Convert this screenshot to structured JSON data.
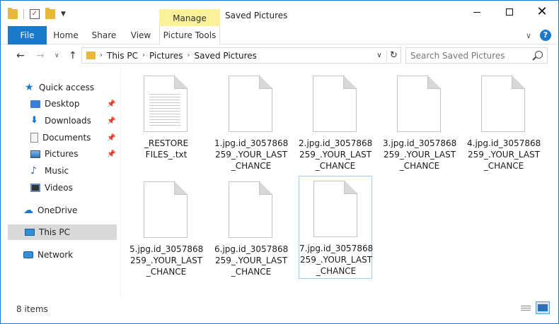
{
  "window": {
    "title": "Saved Pictures",
    "manage_label": "Manage",
    "controls": {
      "minimize": "minimize",
      "maximize": "maximize",
      "close": "✕"
    }
  },
  "ribbon": {
    "tabs": [
      "File",
      "Home",
      "Share",
      "View",
      "Picture Tools"
    ],
    "help": "?"
  },
  "address": {
    "crumbs": [
      "This PC",
      "Pictures",
      "Saved Pictures"
    ]
  },
  "search": {
    "placeholder": "Search Saved Pictures"
  },
  "sidebar": {
    "quick_access": "Quick access",
    "items": [
      {
        "label": "Desktop",
        "icon": "desktop-icon",
        "pinned": true
      },
      {
        "label": "Downloads",
        "icon": "downloads-icon",
        "pinned": true
      },
      {
        "label": "Documents",
        "icon": "documents-icon",
        "pinned": true
      },
      {
        "label": "Pictures",
        "icon": "pictures-icon",
        "pinned": true
      },
      {
        "label": "Music",
        "icon": "music-icon",
        "pinned": false
      },
      {
        "label": "Videos",
        "icon": "videos-icon",
        "pinned": false
      }
    ],
    "onedrive": "OneDrive",
    "this_pc": "This PC",
    "network": "Network"
  },
  "files": [
    {
      "name": "_RESTORE\nFILES_.txt",
      "type": "txt"
    },
    {
      "name": "1.jpg.id_3057868\n259_.YOUR_LAST\n_CHANCE",
      "type": "blank"
    },
    {
      "name": "2.jpg.id_3057868\n259_.YOUR_LAST\n_CHANCE",
      "type": "blank"
    },
    {
      "name": "3.jpg.id_3057868\n259_.YOUR_LAST\n_CHANCE",
      "type": "blank"
    },
    {
      "name": "4.jpg.id_3057868\n259_.YOUR_LAST\n_CHANCE",
      "type": "blank"
    },
    {
      "name": "5.jpg.id_3057868\n259_.YOUR_LAST\n_CHANCE",
      "type": "blank"
    },
    {
      "name": "6.jpg.id_3057868\n259_.YOUR_LAST\n_CHANCE",
      "type": "blank"
    },
    {
      "name": "7.jpg.id_3057868\n259_.YOUR_LAST\n_CHANCE",
      "type": "blank"
    }
  ],
  "status": {
    "count": "8 items"
  },
  "colors": {
    "accent": "#1979ca",
    "manage": "#fbf19a",
    "selected": "#d9d9d9"
  }
}
